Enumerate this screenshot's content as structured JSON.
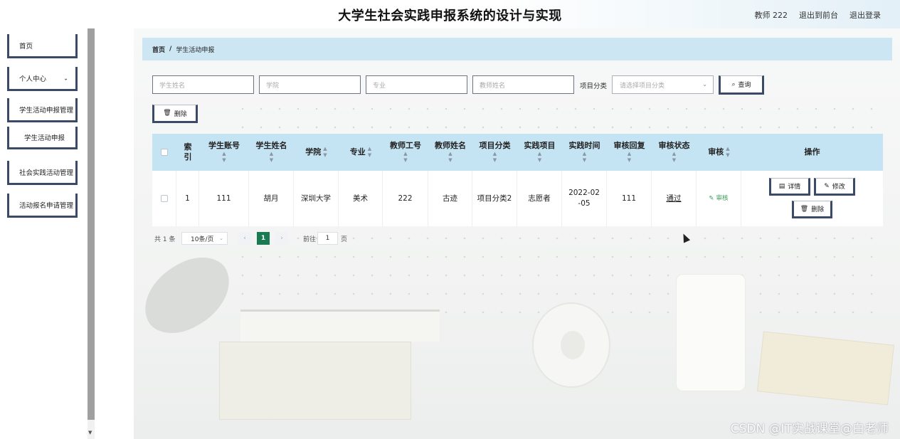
{
  "header": {
    "title": "大学生社会实践申报系统的设计与实现",
    "user": "教师 222",
    "back_front": "退出到前台",
    "logout": "退出登录"
  },
  "sidebar": {
    "items": [
      {
        "label": "首页"
      },
      {
        "label": "个人中心"
      },
      {
        "label": "学生活动申报管理"
      },
      {
        "label": "学生活动申报"
      },
      {
        "label": "社会实践活动管理"
      },
      {
        "label": "活动报名申请管理"
      }
    ]
  },
  "breadcrumb": {
    "home": "首页",
    "sep": "/",
    "current": "学生活动申报"
  },
  "search": {
    "student_name_placeholder": "学生姓名",
    "college_placeholder": "学院",
    "major_placeholder": "专业",
    "teacher_name_placeholder": "教师姓名",
    "category_label": "项目分类",
    "category_placeholder": "请选择项目分类",
    "query_label": "查询"
  },
  "toolbar": {
    "delete_label": "删除"
  },
  "table": {
    "columns": [
      "索引",
      "学生账号",
      "学生姓名",
      "学院",
      "专业",
      "教师工号",
      "教师姓名",
      "项目分类",
      "实践项目",
      "实践时间",
      "审核回复",
      "审核状态",
      "审核",
      "操作"
    ],
    "rows": [
      {
        "index": "1",
        "student_account": "111",
        "student_name": "胡月",
        "college": "深圳大学",
        "major": "美术",
        "teacher_id": "222",
        "teacher_name": "古迹",
        "category": "项目分类2",
        "project": "志愿者",
        "time": "2022-02-05",
        "reply": "111",
        "status": "通过",
        "review_link": "审核",
        "detail_label": "详情",
        "edit_label": "修改",
        "delete_label": "删除"
      }
    ]
  },
  "pagination": {
    "total": "共 1 条",
    "page_size": "10条/页",
    "current_page": "1",
    "goto_label": "前往",
    "goto_value": "1",
    "page_suffix": "页"
  },
  "watermark": "CSDN @IT实战课堂@白老师"
}
